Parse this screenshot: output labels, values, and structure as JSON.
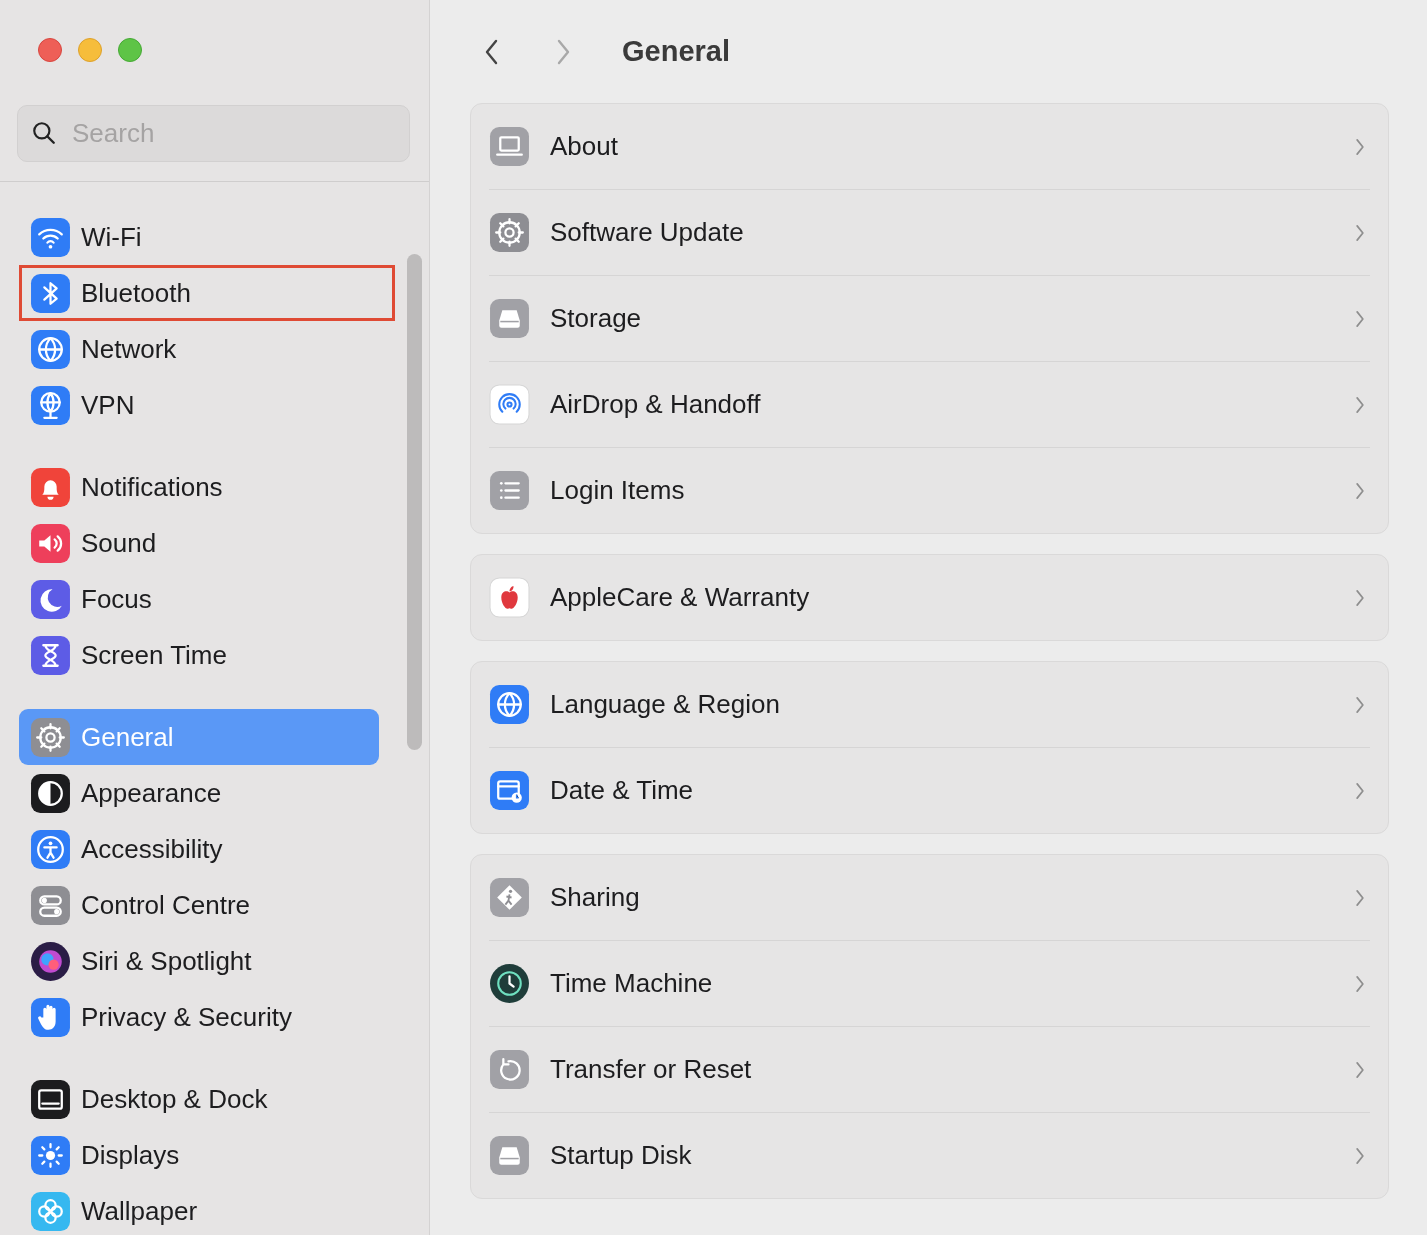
{
  "toolbar": {
    "back": {
      "disabled": false
    },
    "forward": {
      "disabled": true
    },
    "title": "General"
  },
  "search": {
    "placeholder": "Search"
  },
  "sidebar": {
    "groups": [
      [
        {
          "label": "Wi-Fi",
          "kind": "wifi",
          "selected": false,
          "highlighted": false
        },
        {
          "label": "Bluetooth",
          "kind": "bluetooth",
          "selected": false,
          "highlighted": true
        },
        {
          "label": "Network",
          "kind": "globe",
          "selected": false,
          "highlighted": false
        },
        {
          "label": "VPN",
          "kind": "vpn",
          "selected": false,
          "highlighted": false
        }
      ],
      [
        {
          "label": "Notifications",
          "kind": "bell",
          "selected": false,
          "highlighted": false
        },
        {
          "label": "Sound",
          "kind": "sound",
          "selected": false,
          "highlighted": false
        },
        {
          "label": "Focus",
          "kind": "moon",
          "selected": false,
          "highlighted": false
        },
        {
          "label": "Screen Time",
          "kind": "hourglass",
          "selected": false,
          "highlighted": false
        }
      ],
      [
        {
          "label": "General",
          "kind": "gear",
          "selected": true,
          "highlighted": false
        },
        {
          "label": "Appearance",
          "kind": "appearance",
          "selected": false,
          "highlighted": false
        },
        {
          "label": "Accessibility",
          "kind": "accessibility",
          "selected": false,
          "highlighted": false
        },
        {
          "label": "Control Centre",
          "kind": "toggles",
          "selected": false,
          "highlighted": false
        },
        {
          "label": "Siri & Spotlight",
          "kind": "siri",
          "selected": false,
          "highlighted": false
        },
        {
          "label": "Privacy & Security",
          "kind": "hand",
          "selected": false,
          "highlighted": false
        }
      ],
      [
        {
          "label": "Desktop & Dock",
          "kind": "dock",
          "selected": false,
          "highlighted": false
        },
        {
          "label": "Displays",
          "kind": "sun",
          "selected": false,
          "highlighted": false
        },
        {
          "label": "Wallpaper",
          "kind": "flower",
          "selected": false,
          "highlighted": false
        }
      ]
    ]
  },
  "cards": [
    [
      {
        "label": "About",
        "kind": "laptop"
      },
      {
        "label": "Software Update",
        "kind": "gear"
      },
      {
        "label": "Storage",
        "kind": "drive"
      },
      {
        "label": "AirDrop & Handoff",
        "kind": "airdrop"
      },
      {
        "label": "Login Items",
        "kind": "list"
      }
    ],
    [
      {
        "label": "AppleCare & Warranty",
        "kind": "apple"
      }
    ],
    [
      {
        "label": "Language & Region",
        "kind": "globe"
      },
      {
        "label": "Date & Time",
        "kind": "calendar"
      }
    ],
    [
      {
        "label": "Sharing",
        "kind": "sharing"
      },
      {
        "label": "Time Machine",
        "kind": "clock"
      },
      {
        "label": "Transfer or Reset",
        "kind": "reset"
      },
      {
        "label": "Startup Disk",
        "kind": "drive"
      }
    ]
  ]
}
